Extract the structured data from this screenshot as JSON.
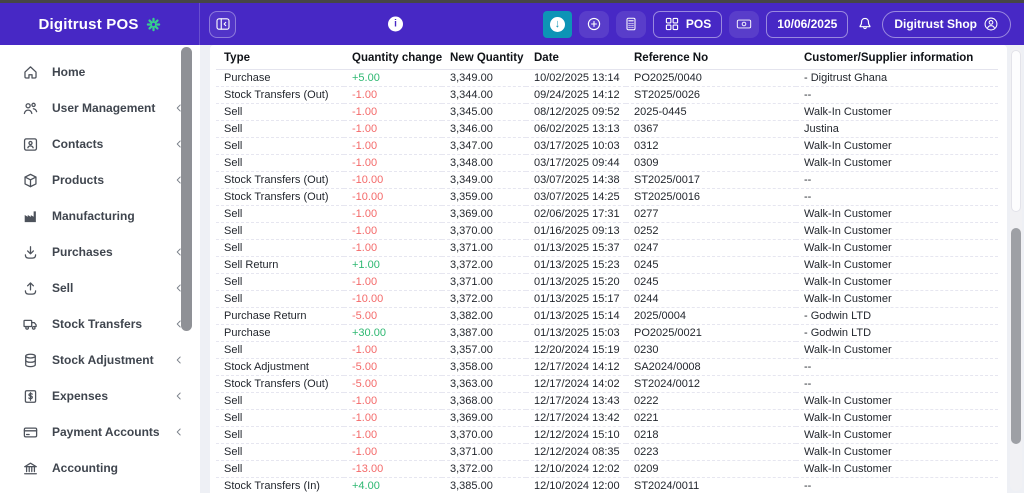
{
  "header": {
    "brand": "Digitrust POS",
    "pos_label": "POS",
    "date": "10/06/2025",
    "shop_name": "Digitrust Shop"
  },
  "sidebar": {
    "items": [
      {
        "label": "Home",
        "icon": "home",
        "expandable": false
      },
      {
        "label": "User Management",
        "icon": "users",
        "expandable": true
      },
      {
        "label": "Contacts",
        "icon": "contact-card",
        "expandable": true
      },
      {
        "label": "Products",
        "icon": "box",
        "expandable": true
      },
      {
        "label": "Manufacturing",
        "icon": "factory",
        "expandable": false
      },
      {
        "label": "Purchases",
        "icon": "download",
        "expandable": true
      },
      {
        "label": "Sell",
        "icon": "upload",
        "expandable": true
      },
      {
        "label": "Stock Transfers",
        "icon": "truck",
        "expandable": true
      },
      {
        "label": "Stock Adjustment",
        "icon": "database",
        "expandable": true
      },
      {
        "label": "Expenses",
        "icon": "dollar",
        "expandable": true
      },
      {
        "label": "Payment Accounts",
        "icon": "credit-card",
        "expandable": true
      },
      {
        "label": "Accounting",
        "icon": "bank",
        "expandable": false
      }
    ]
  },
  "table": {
    "columns": [
      "Type",
      "Quantity change",
      "New Quantity",
      "Date",
      "Reference No",
      "Customer/Supplier information"
    ],
    "rows": [
      {
        "type": "Purchase",
        "change": "+5.00",
        "new_qty": "3,349.00",
        "date": "10/02/2025 13:14",
        "ref": "PO2025/0040",
        "customer": "- Digitrust Ghana"
      },
      {
        "type": "Stock Transfers (Out)",
        "change": "-1.00",
        "new_qty": "3,344.00",
        "date": "09/24/2025 14:12",
        "ref": "ST2025/0026",
        "customer": "--"
      },
      {
        "type": "Sell",
        "change": "-1.00",
        "new_qty": "3,345.00",
        "date": "08/12/2025 09:52",
        "ref": "2025-0445",
        "customer": "Walk-In Customer"
      },
      {
        "type": "Sell",
        "change": "-1.00",
        "new_qty": "3,346.00",
        "date": "06/02/2025 13:13",
        "ref": "0367",
        "customer": "Justina"
      },
      {
        "type": "Sell",
        "change": "-1.00",
        "new_qty": "3,347.00",
        "date": "03/17/2025 10:03",
        "ref": "0312",
        "customer": "Walk-In Customer"
      },
      {
        "type": "Sell",
        "change": "-1.00",
        "new_qty": "3,348.00",
        "date": "03/17/2025 09:44",
        "ref": "0309",
        "customer": "Walk-In Customer"
      },
      {
        "type": "Stock Transfers (Out)",
        "change": "-10.00",
        "new_qty": "3,349.00",
        "date": "03/07/2025 14:38",
        "ref": "ST2025/0017",
        "customer": "--"
      },
      {
        "type": "Stock Transfers (Out)",
        "change": "-10.00",
        "new_qty": "3,359.00",
        "date": "03/07/2025 14:25",
        "ref": "ST2025/0016",
        "customer": "--"
      },
      {
        "type": "Sell",
        "change": "-1.00",
        "new_qty": "3,369.00",
        "date": "02/06/2025 17:31",
        "ref": "0277",
        "customer": "Walk-In Customer"
      },
      {
        "type": "Sell",
        "change": "-1.00",
        "new_qty": "3,370.00",
        "date": "01/16/2025 09:13",
        "ref": "0252",
        "customer": "Walk-In Customer"
      },
      {
        "type": "Sell",
        "change": "-1.00",
        "new_qty": "3,371.00",
        "date": "01/13/2025 15:37",
        "ref": "0247",
        "customer": "Walk-In Customer"
      },
      {
        "type": "Sell Return",
        "change": "+1.00",
        "new_qty": "3,372.00",
        "date": "01/13/2025 15:23",
        "ref": "0245",
        "customer": "Walk-In Customer"
      },
      {
        "type": "Sell",
        "change": "-1.00",
        "new_qty": "3,371.00",
        "date": "01/13/2025 15:20",
        "ref": "0245",
        "customer": "Walk-In Customer"
      },
      {
        "type": "Sell",
        "change": "-10.00",
        "new_qty": "3,372.00",
        "date": "01/13/2025 15:17",
        "ref": "0244",
        "customer": "Walk-In Customer"
      },
      {
        "type": "Purchase Return",
        "change": "-5.00",
        "new_qty": "3,382.00",
        "date": "01/13/2025 15:14",
        "ref": "2025/0004",
        "customer": "- Godwin LTD"
      },
      {
        "type": "Purchase",
        "change": "+30.00",
        "new_qty": "3,387.00",
        "date": "01/13/2025 15:03",
        "ref": "PO2025/0021",
        "customer": "- Godwin LTD"
      },
      {
        "type": "Sell",
        "change": "-1.00",
        "new_qty": "3,357.00",
        "date": "12/20/2024 15:19",
        "ref": "0230",
        "customer": "Walk-In Customer"
      },
      {
        "type": "Stock Adjustment",
        "change": "-5.00",
        "new_qty": "3,358.00",
        "date": "12/17/2024 14:12",
        "ref": "SA2024/0008",
        "customer": "--"
      },
      {
        "type": "Stock Transfers (Out)",
        "change": "-5.00",
        "new_qty": "3,363.00",
        "date": "12/17/2024 14:02",
        "ref": "ST2024/0012",
        "customer": "--"
      },
      {
        "type": "Sell",
        "change": "-1.00",
        "new_qty": "3,368.00",
        "date": "12/17/2024 13:43",
        "ref": "0222",
        "customer": "Walk-In Customer"
      },
      {
        "type": "Sell",
        "change": "-1.00",
        "new_qty": "3,369.00",
        "date": "12/17/2024 13:42",
        "ref": "0221",
        "customer": "Walk-In Customer"
      },
      {
        "type": "Sell",
        "change": "-1.00",
        "new_qty": "3,370.00",
        "date": "12/12/2024 15:10",
        "ref": "0218",
        "customer": "Walk-In Customer"
      },
      {
        "type": "Sell",
        "change": "-1.00",
        "new_qty": "3,371.00",
        "date": "12/12/2024 08:35",
        "ref": "0223",
        "customer": "Walk-In Customer"
      },
      {
        "type": "Sell",
        "change": "-13.00",
        "new_qty": "3,372.00",
        "date": "12/10/2024 12:02",
        "ref": "0209",
        "customer": "Walk-In Customer"
      },
      {
        "type": "Stock Transfers (In)",
        "change": "+4.00",
        "new_qty": "3,385.00",
        "date": "12/10/2024 12:00",
        "ref": "ST2024/0011",
        "customer": "--"
      }
    ]
  },
  "colors": {
    "header_purple": "#4728c5",
    "teal_action": "#0d94b6",
    "positive": "#2eb872",
    "negative": "#f46a6a",
    "logo_green": "#35d08e"
  }
}
